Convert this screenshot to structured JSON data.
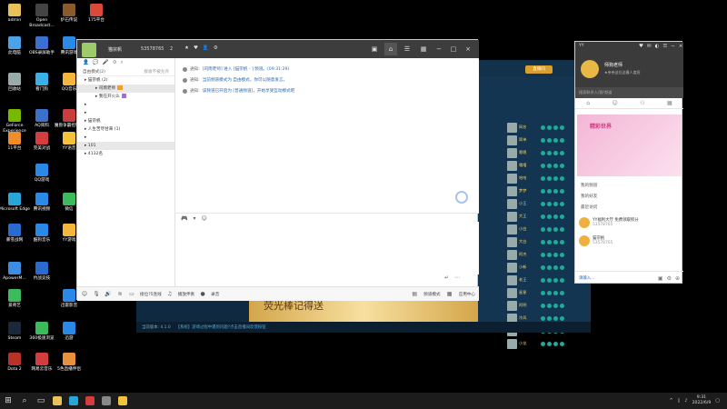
{
  "desktop": {
    "icons": [
      {
        "label": "admin",
        "color": "#e8c15a"
      },
      {
        "label": "Open Broadcast...",
        "color": "#444"
      },
      {
        "label": "炉石传说",
        "color": "#8a5a2c"
      },
      {
        "label": "175平台",
        "color": "#d94a3a"
      },
      {
        "label": "此电脑",
        "color": "#4aa3e8"
      },
      {
        "label": "OBS录屏助手",
        "color": "#3c6fd0"
      },
      {
        "label": "腾讯游戏",
        "color": "#2a8ae6"
      },
      {
        "label": "回收站",
        "color": "#9aa"
      },
      {
        "label": "看门狗",
        "color": "#3ab0e6"
      },
      {
        "label": "QQ音乐",
        "color": "#f4b73c"
      },
      {
        "label": "GeForce Experience",
        "color": "#76b900"
      },
      {
        "label": "AQ资料",
        "color": "#3d70c8"
      },
      {
        "label": "魔兽争霸控制台",
        "color": "#c83d3d"
      },
      {
        "label": "11平台",
        "color": "#ef8c2b"
      },
      {
        "label": "完美对战",
        "color": "#d43d3d"
      },
      {
        "label": "YY语音",
        "color": "#f2c23c"
      },
      {
        "label": "QQ游戏",
        "color": "#2a88e6"
      },
      {
        "label": "Microsoft Edge",
        "color": "#2aa5d8"
      },
      {
        "label": "腾讯视频",
        "color": "#2a8ae6"
      },
      {
        "label": "微信",
        "color": "#3dbb5a"
      },
      {
        "label": "暴雪战网",
        "color": "#2a6bd0"
      },
      {
        "label": "酷狗音乐",
        "color": "#2a88e6"
      },
      {
        "label": "YY游戏",
        "color": "#f4b73c"
      },
      {
        "label": "ApowerM...",
        "color": "#3d8de0"
      },
      {
        "label": "约战竞技",
        "color": "#2a6bd0"
      },
      {
        "label": "爱奇艺",
        "color": "#3dbb5a"
      },
      {
        "label": "迅雷影音",
        "color": "#2a88e6"
      },
      {
        "label": "Steam",
        "color": "#1b2838"
      },
      {
        "label": "360极速浏览",
        "color": "#3dbb5a"
      },
      {
        "label": "迅游",
        "color": "#2a88e6"
      },
      {
        "label": "Dota 2",
        "color": "#b83228"
      },
      {
        "label": "网易云音乐",
        "color": "#d43d3d"
      },
      {
        "label": "5色直播伴侣",
        "color": "#e8903c"
      }
    ]
  },
  "taskbar": {
    "time": "9:31",
    "date": "2022/6/9"
  },
  "chat": {
    "title": "猫宗帆",
    "uid": "53578765",
    "people": "2",
    "messages": [
      {
        "label": "通知:",
        "text": "[司雨老师] 进入 [猫宗帆 - ] 频道。(09:31:29)"
      },
      {
        "label": "通知:",
        "text": "当前频道模式为 自由模式，你可以随意发言。"
      },
      {
        "label": "通知:",
        "text": "该频道已开启为 [普通频道]，开始享受互动模式吧"
      }
    ],
    "sidebar": {
      "mode": "自由模式",
      "mode_count": "(2)",
      "mode_link": "接收不被允许",
      "tree": [
        {
          "text": "猫宗帆 (2)",
          "indent": 8,
          "sel": false
        },
        {
          "text": "司雨老师",
          "indent": 20,
          "sel": true,
          "tag": true
        },
        {
          "text": "我在开火么",
          "indent": 20,
          "sel": false,
          "tag2": true
        },
        {
          "text": "",
          "indent": 8,
          "sel": false
        },
        {
          "text": "",
          "indent": 8,
          "sel": false
        },
        {
          "text": "猫宗帆",
          "indent": 8,
          "sel": false
        },
        {
          "text": "人生苦尽甘来 (1)",
          "indent": 8,
          "sel": false
        },
        {
          "text": "",
          "indent": 8,
          "sel": false
        },
        {
          "text": "101",
          "indent": 8,
          "sel": true
        },
        {
          "text": "4132名",
          "indent": 8,
          "sel": false
        }
      ]
    },
    "bottombar": {
      "left_a": "接位?5连线",
      "left_b": "播放伴奏",
      "left_c": "录音",
      "right_a": "频道模式",
      "right_b": "应用中心"
    }
  },
  "game": {
    "footer_left": "当前版本: 4.1.0",
    "footer_mid": "【系统】游戏过程中遇到问题?点击直播间反馈按钮",
    "banner_text": "荧光棒记得送",
    "gold_btn": "直播间",
    "rows": [
      "网名",
      "简单",
      "嗯嗯",
      "嘻嘻",
      "哈哈",
      "梦梦",
      "小王",
      "大王",
      "小白",
      "大白",
      "阿杰",
      "小新",
      "老王",
      "星星",
      "阿明",
      "冷风",
      "灵宝",
      "小龙"
    ]
  },
  "friends": {
    "yy": "YY",
    "name": "师狗老师",
    "signature": "★亲亲这位这最人度班",
    "search_placeholder": "搜索联系人/群/频道",
    "banner_title": "精彩世界",
    "sections": [
      "我的频道",
      "我的好友",
      "最近访问"
    ],
    "contacts": [
      {
        "name": "YY福利大厅 免费领取积分",
        "sub": "53578765"
      },
      {
        "name": "猫宗帆",
        "sub": "53578765"
      }
    ],
    "input_text": "请输入..."
  }
}
